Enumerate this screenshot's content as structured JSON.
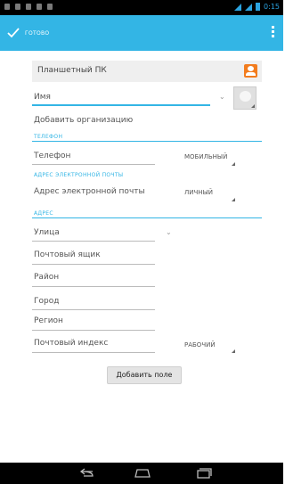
{
  "actionbar": {
    "done_label": "ГОТОВО"
  },
  "status": {
    "time": "0:15"
  },
  "account": {
    "label": "Планшетный ПК"
  },
  "name": {
    "placeholder": "Имя"
  },
  "organization": {
    "label": "Добавить организацию"
  },
  "phone": {
    "section": "ТЕЛЕФОН",
    "placeholder": "Телефон",
    "type": "МОБИЛЬНЫЙ"
  },
  "email": {
    "section": "АДРЕС ЭЛЕКТРОННОЙ ПОЧТЫ",
    "placeholder": "Адрес электронной почты",
    "type": "ЛИЧНЫЙ"
  },
  "address": {
    "section": "АДРЕС",
    "street": "Улица",
    "pobox": "Почтовый ящик",
    "district": "Район",
    "city": "Город",
    "region": "Регион",
    "postcode": "Почтовый индекс",
    "type": "РАБОЧИЙ"
  },
  "add_field_label": "Добавить поле",
  "colors": {
    "accent": "#33b5e5",
    "account_icon": "#f27c1e"
  }
}
